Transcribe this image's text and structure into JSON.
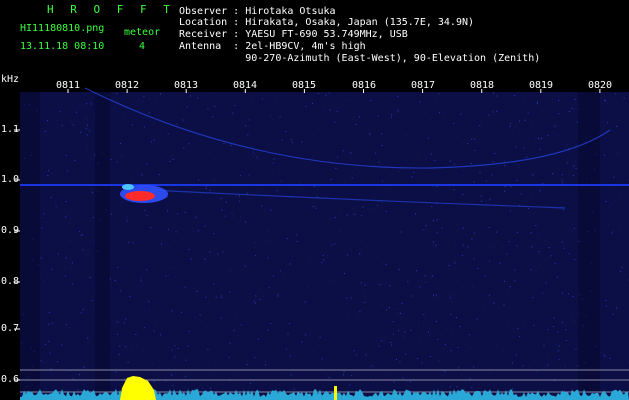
{
  "header": {
    "logo": "H R O F F T",
    "filename": "HI11180810.png",
    "date_time": "13.11.18 08:10",
    "meteor_label": "meteor",
    "meteor_count": "4",
    "info_lines": [
      "Observer : Hirotaka Otsuka",
      "Location : Hirakata, Osaka, Japan (135.7E, 34.9N)",
      "Receiver : YAESU FT-690 53.749MHz, USB",
      "Antenna  : 2el-HB9CV, 4m's high",
      "           90-270-Azimuth (East-West), 90-Elevation (Zenith)"
    ]
  },
  "axes": {
    "y_unit": "kHz",
    "y_ticks": [
      "1.1",
      "1.0",
      "0.9",
      "0.8",
      "0.7",
      "0.6"
    ],
    "x_ticks": [
      "0811",
      "0812",
      "0813",
      "0814",
      "0815",
      "0816",
      "0817",
      "0818",
      "0819",
      "0820"
    ]
  },
  "colors": {
    "background": "#000000",
    "spectrogram": "#0b0f45",
    "noise_band": "#1c3dff",
    "meteor_echo": "#ff2a2a",
    "signal_bar": "#ffff00",
    "noise_floor": "#2aa8d8",
    "text_green": "#3cff3c",
    "text_white": "#ffffff"
  }
}
